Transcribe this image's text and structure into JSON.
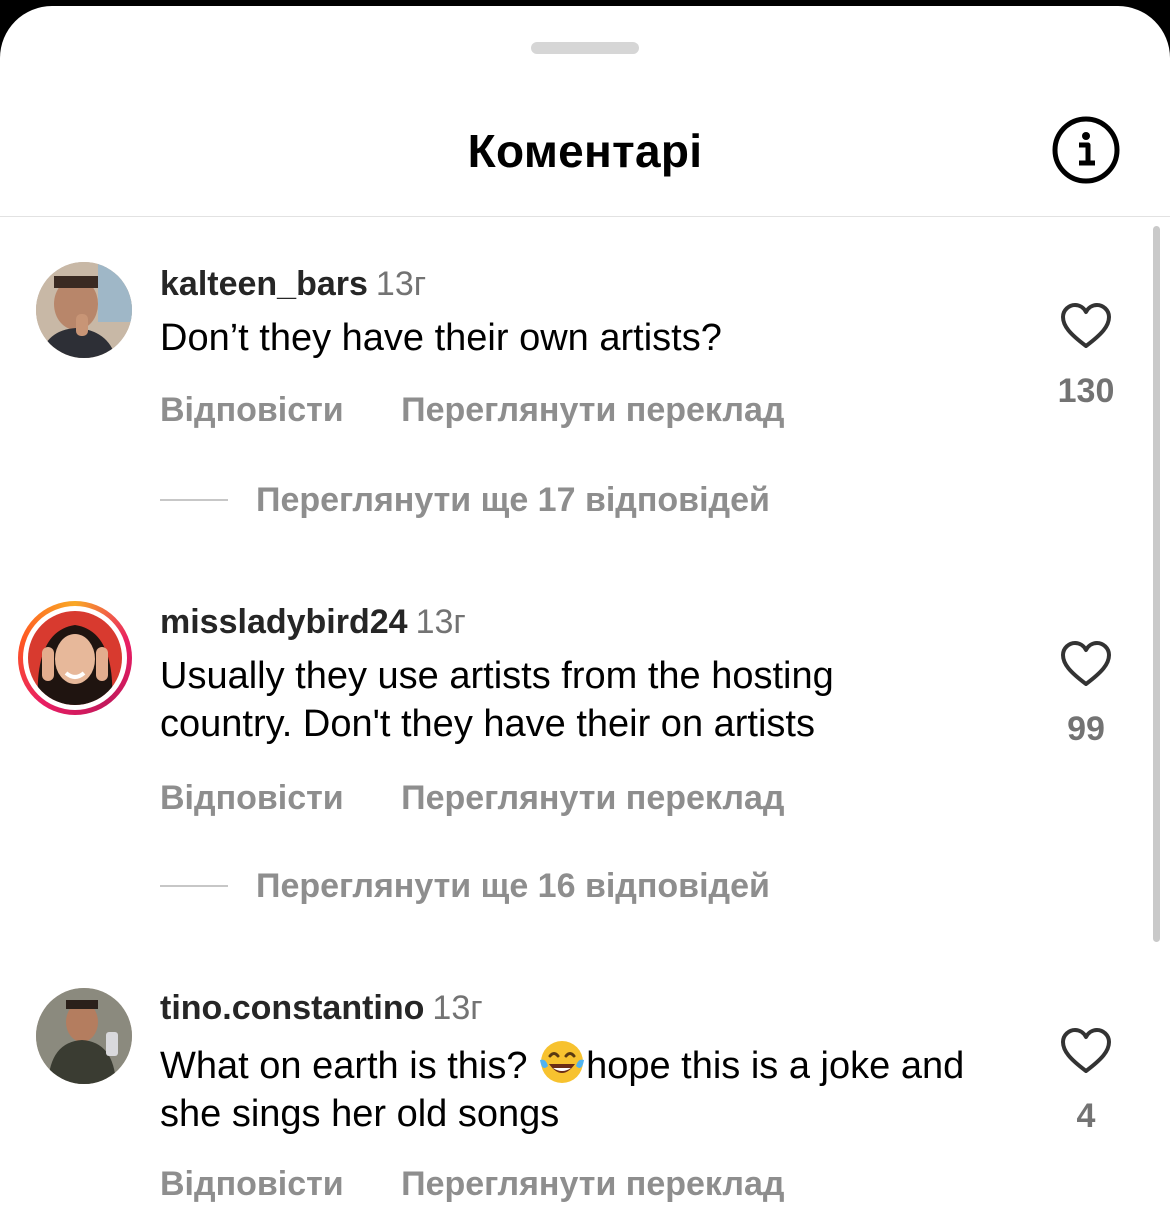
{
  "header": {
    "title": "Коментарі",
    "info_icon": "info-icon"
  },
  "comments": [
    {
      "username": "kalteen_bars",
      "time": "13г",
      "text": "Don’t they have their own artists?",
      "reply_label": "Відповісти",
      "translate_label": "Переглянути переклад",
      "likes": "130",
      "view_replies": "Переглянути ще 17 відповідей",
      "story_ring": false
    },
    {
      "username": "missladybird24",
      "time": "13г",
      "text": "Usually they use artists from the hosting country. Don't they have their on artists",
      "reply_label": "Відповісти",
      "translate_label": "Переглянути переклад",
      "likes": "99",
      "view_replies": "Переглянути ще 16 відповідей",
      "story_ring": true
    },
    {
      "username": "tino.constantino",
      "time": "13г",
      "text_before_emoji": "What on earth is this? ",
      "emoji": "face-with-tears-of-joy",
      "text_after_emoji": "hope this is a joke and she sings her old songs",
      "reply_label": "Відповісти",
      "translate_label": "Переглянути переклад",
      "likes": "4",
      "story_ring": false
    }
  ],
  "colors": {
    "story_ring": [
      "#f9a825",
      "#e91e63"
    ],
    "muted": "#8e8e8e"
  }
}
